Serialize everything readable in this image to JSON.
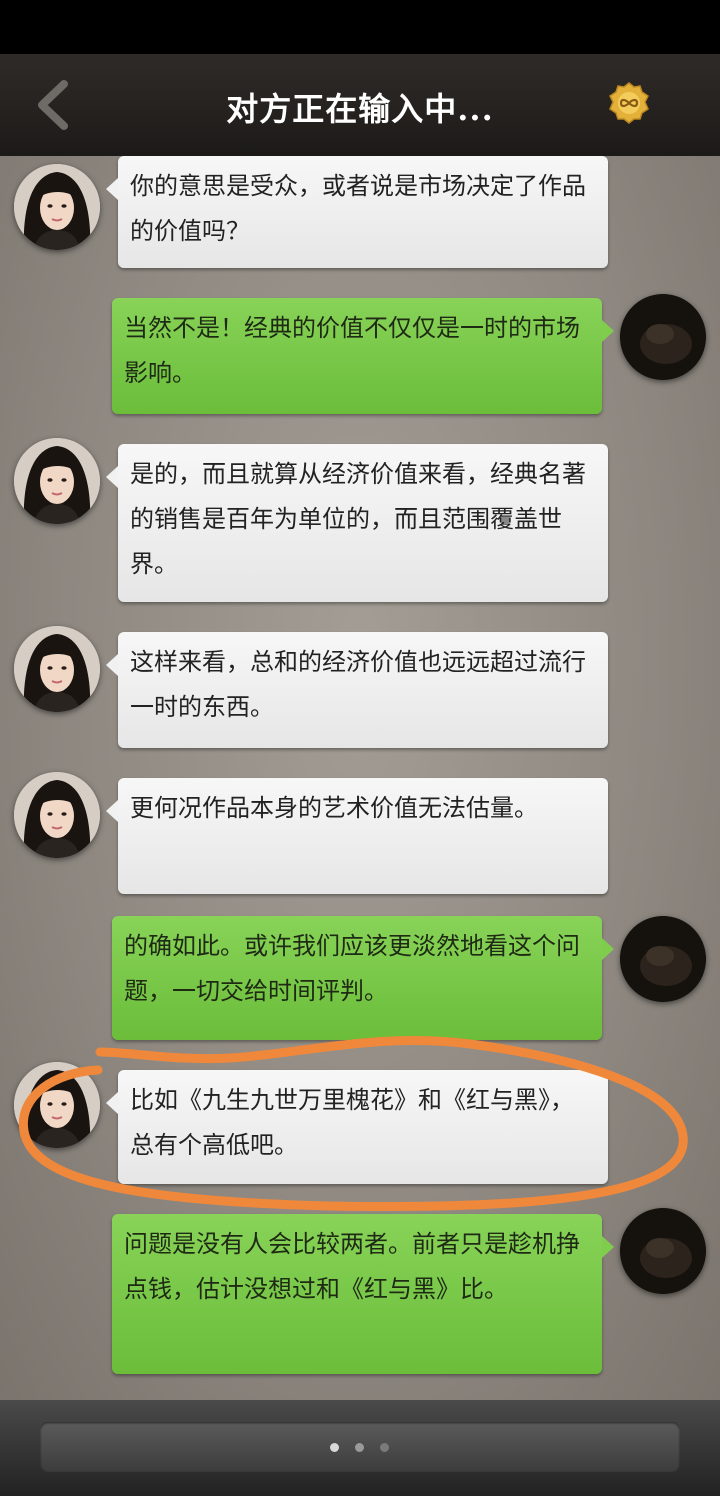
{
  "header": {
    "title": "对方正在输入中..."
  },
  "messages": [
    {
      "side": "left",
      "text": "你的意思是受众，或者说是市场决定了作品的价值吗？"
    },
    {
      "side": "right",
      "text": "当然不是！经典的价值不仅仅是一时的市场影响。"
    },
    {
      "side": "left",
      "text": "是的，而且就算从经济价值来看，经典名著的销售是百年为单位的，而且范围覆盖世界。"
    },
    {
      "side": "left",
      "text": "这样来看，总和的经济价值也远远超过流行一时的东西。"
    },
    {
      "side": "left",
      "text": "更何况作品本身的艺术价值无法估量。"
    },
    {
      "side": "right",
      "text": "的确如此。或许我们应该更淡然地看这个问题，一切交给时间评判。"
    },
    {
      "side": "left",
      "text": "比如《九生九世万里槐花》和《红与黑》，总有个高低吧。"
    },
    {
      "side": "right",
      "text": "问题是没有人会比较两者。前者只是趁机挣点钱，估计没想过和《红与黑》比。"
    }
  ],
  "colors": {
    "incoming_bubble": "#f0f0f0",
    "outgoing_bubble": "#7cc84a",
    "highlight_ring": "#f0883c",
    "header_bg": "#2a2724",
    "chat_bg": "#8f8982"
  },
  "pagination": {
    "pages": 3,
    "active": 0
  }
}
